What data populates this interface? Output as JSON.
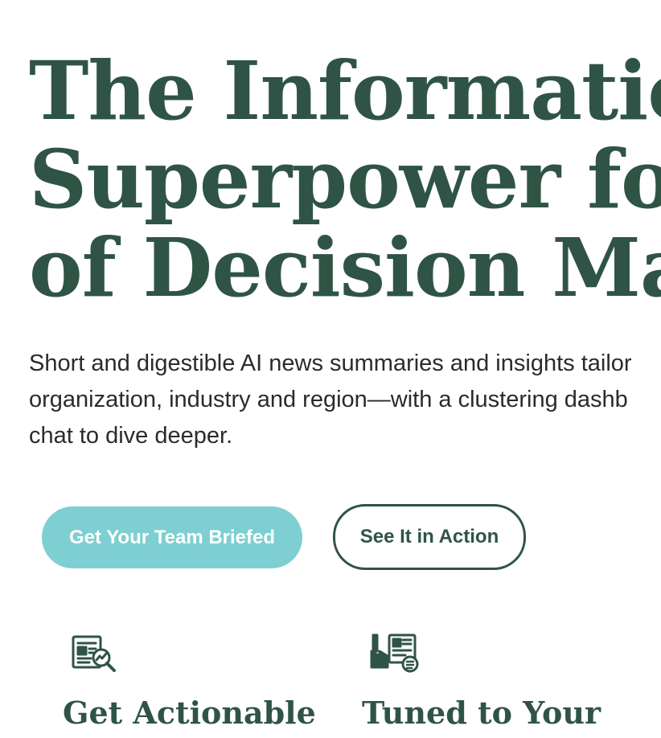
{
  "hero": {
    "title_lines": [
      "The Information",
      "Superpower for T",
      "of Decision Make"
    ],
    "subtitle_lines": [
      "Short and digestible AI news summaries and insights tailor",
      "organization, industry and region—with a clustering dashb",
      "chat to dive deeper."
    ]
  },
  "buttons": {
    "primary_label": "Get Your Team Briefed",
    "secondary_label": "See It in Action"
  },
  "features": [
    {
      "icon": "news-analytics-icon",
      "title": "Get Actionable"
    },
    {
      "icon": "industry-news-icon",
      "title": "Tuned to Your"
    }
  ],
  "colors": {
    "brand_green": "#2f5446",
    "primary_button": "#7ecfd1",
    "text": "#2b2b2b"
  }
}
